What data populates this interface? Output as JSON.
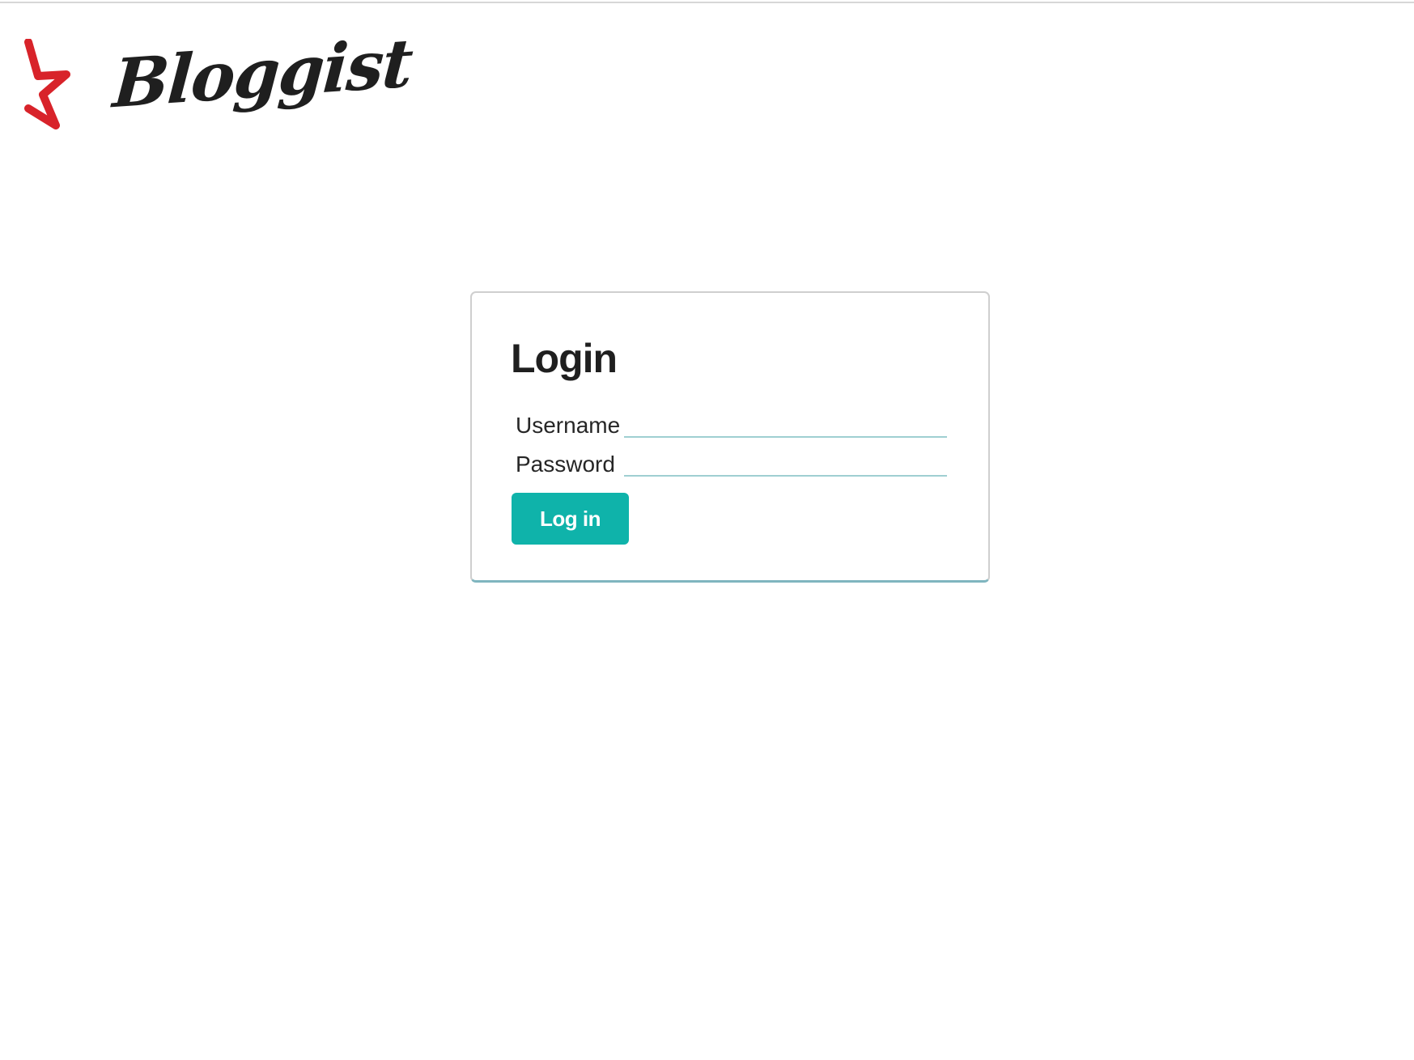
{
  "brand": {
    "name": "Bloggist",
    "mark_color": "#d8232a",
    "text_color": "#1f1f1f"
  },
  "login": {
    "title": "Login",
    "username_label": "Username",
    "username_value": "",
    "password_label": "Password",
    "password_value": "",
    "submit_label": "Log in"
  },
  "colors": {
    "accent": "#0fb3aa",
    "card_border": "#cfcfcf",
    "card_bottom_border": "#7fb5bf",
    "input_underline": "#9fcfd2"
  }
}
